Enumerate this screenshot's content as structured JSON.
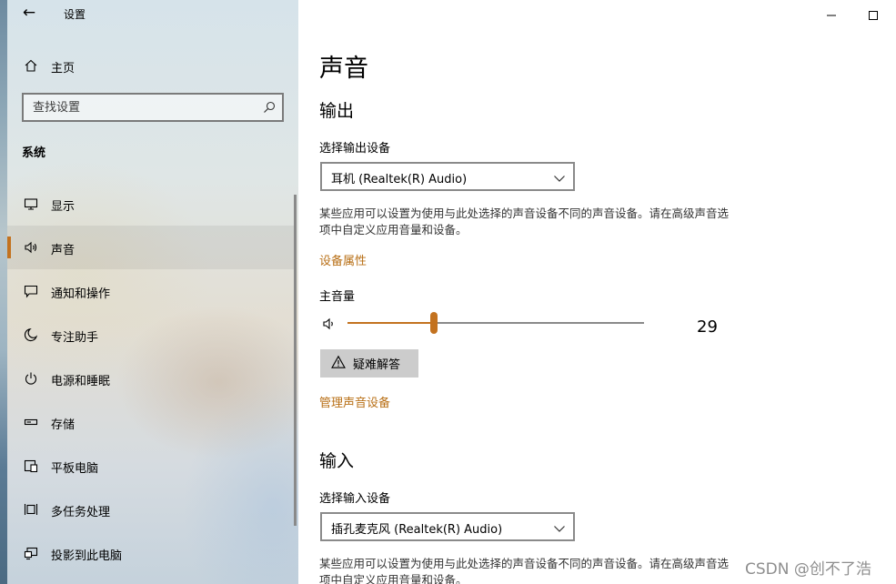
{
  "colors": {
    "accent": "#c3721f",
    "link": "#b86f16",
    "button_bg": "#cccccc"
  },
  "window": {
    "app_title": "设置",
    "back_icon": "arrow-left-icon",
    "minimize_icon": "minimize-icon",
    "maximize_icon": "maximize-icon"
  },
  "sidebar": {
    "home": {
      "label": "主页",
      "icon": "home-icon"
    },
    "search": {
      "placeholder": "查找设置",
      "icon": "search-icon"
    },
    "section_title": "系统",
    "items": [
      {
        "label": "显示",
        "icon": "monitor-icon",
        "selected": false
      },
      {
        "label": "声音",
        "icon": "speaker-icon",
        "selected": true
      },
      {
        "label": "通知和操作",
        "icon": "notification-icon",
        "selected": false
      },
      {
        "label": "专注助手",
        "icon": "moon-icon",
        "selected": false
      },
      {
        "label": "电源和睡眠",
        "icon": "power-icon",
        "selected": false
      },
      {
        "label": "存储",
        "icon": "storage-icon",
        "selected": false
      },
      {
        "label": "平板电脑",
        "icon": "tablet-icon",
        "selected": false
      },
      {
        "label": "多任务处理",
        "icon": "multitask-icon",
        "selected": false
      },
      {
        "label": "投影到此电脑",
        "icon": "projector-icon",
        "selected": false
      }
    ]
  },
  "main": {
    "page_title": "声音",
    "output": {
      "title": "输出",
      "device_label": "选择输出设备",
      "device_value": "耳机 (Realtek(R) Audio)",
      "description": "某些应用可以设置为使用与此处选择的声音设备不同的声音设备。请在高级声音选项中自定义应用音量和设备。",
      "properties_link": "设备属性",
      "volume_label": "主音量",
      "volume_icon": "speaker-volume-icon",
      "volume_value": 29,
      "volume_text": "29",
      "troubleshoot_label": "疑难解答",
      "troubleshoot_icon": "warning-icon",
      "manage_link": "管理声音设备"
    },
    "input": {
      "title": "输入",
      "device_label": "选择输入设备",
      "device_value": "插孔麦克风 (Realtek(R) Audio)",
      "description": "某些应用可以设置为使用与此处选择的声音设备不同的声音设备。请在高级声音选项中自定义应用音量和设备。"
    }
  },
  "watermark": "CSDN @创不了浩"
}
